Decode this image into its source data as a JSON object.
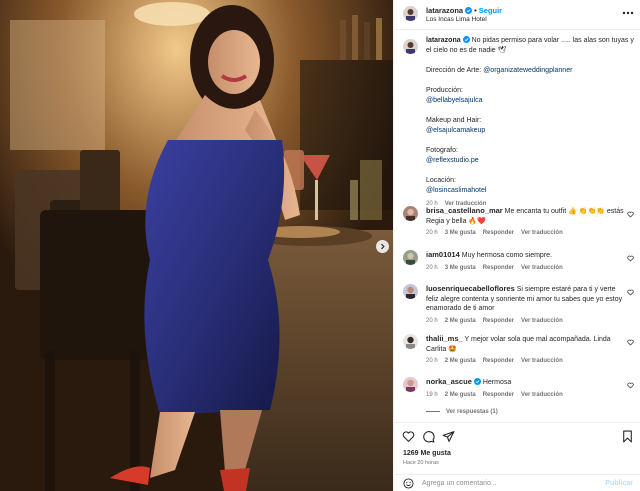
{
  "post": {
    "author": "latarazona",
    "dot": "•",
    "follow_label": "Seguir",
    "location": "Los Incas Lima Hotel",
    "caption": {
      "text": "No pidas permiso para volar ..... las alas son tuyas y el cielo no es de nadie 🕊",
      "lines": [
        "Dirección de Arte: @organizateweddingplanner",
        "",
        "Producción:",
        "@bellabyelsajulca",
        "",
        "Makeup and Hair:",
        "@elsajulcamakeup",
        "",
        "Fotografo:",
        "@reflexstudio.pe",
        "",
        "Locación:",
        "@losincaslimahotel"
      ],
      "time": "20 h",
      "translate": "Ver traducción"
    }
  },
  "comments": [
    {
      "user": "brisa_castellano_mar",
      "text": "Me encanta tu outfit 👍 👏👏👏 estás Regia y bella 🔥❤️",
      "time": "20 h",
      "likes": "3 Me gusta",
      "reply": "Responder",
      "translate": "Ver traducción"
    },
    {
      "user": "iam01014",
      "text": "Muy hermosa como siempre.",
      "time": "20 h",
      "likes": "3 Me gusta",
      "reply": "Responder",
      "translate": "Ver traducción"
    },
    {
      "user": "luosenriquecabelloflores",
      "text": "Si siempre estaré para ti y verte feliz alegre contenta y sonriente mi amor tu sabes que yo estoy enamorado de ti amor",
      "time": "20 h",
      "likes": "2 Me gusta",
      "reply": "Responder",
      "translate": "Ver traducción"
    },
    {
      "user": "thalii_ms_",
      "text": "Y mejor volar sola que mal acompañada. Linda Carlita 🤩",
      "time": "20 h",
      "likes": "2 Me gusta",
      "reply": "Responder",
      "translate": "Ver traducción"
    },
    {
      "user": "norka_ascue",
      "text": "Hermosa",
      "time": "19 h",
      "likes": "2 Me gusta",
      "reply": "Responder",
      "translate": "Ver traducción"
    }
  ],
  "view_replies": "Ver respuestas (1)",
  "footer": {
    "likes": "1269 Me gusta",
    "posted": "Hace 20 horas",
    "placeholder": "Agrega un comentario...",
    "publish": "Publicar"
  },
  "icons": {
    "heart": "heart-icon",
    "comment": "comment-icon",
    "share": "share-icon",
    "save": "bookmark-icon",
    "verified": "verified-badge-icon",
    "more": "more-options-icon",
    "emoji": "emoji-icon",
    "next": "chevron-right-icon"
  },
  "colors": {
    "accent": "#0095f6",
    "link": "#00376b",
    "dress": "#2a2f7a",
    "muted": "#737373"
  }
}
